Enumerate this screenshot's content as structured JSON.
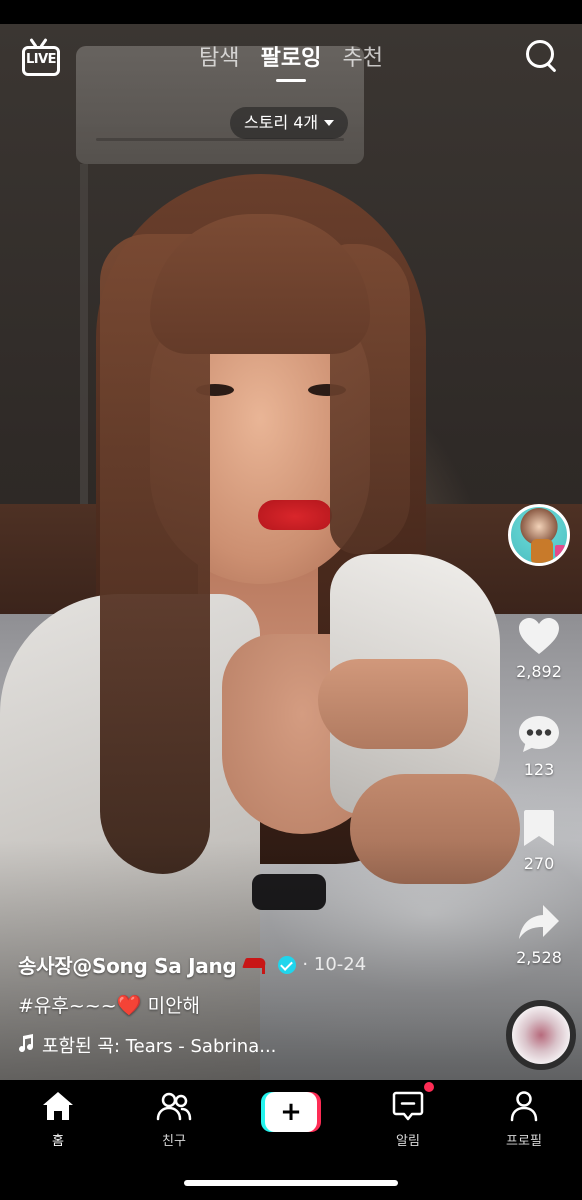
{
  "top_bar": {
    "live_label": "LIVE",
    "tabs": [
      {
        "label": "탐색",
        "active": false
      },
      {
        "label": "팔로잉",
        "active": true
      },
      {
        "label": "추천",
        "active": false
      }
    ],
    "story_pill": "스토리 4개"
  },
  "rail": {
    "likes": "2,892",
    "comments": "123",
    "saves": "270",
    "shares": "2,528"
  },
  "caption": {
    "author": "송사장@Song Sa Jang",
    "date": "· 10-24",
    "text_before": "#유후~~~",
    "heart": "❤️",
    "text_after": "미안해",
    "music": "포함된 곡: Tears - Sabrina..."
  },
  "bottom_nav": {
    "items": [
      {
        "label": "홈",
        "active": true
      },
      {
        "label": "친구",
        "active": false
      },
      {
        "label": "알림",
        "active": false
      },
      {
        "label": "프로필",
        "active": false
      }
    ]
  },
  "colors": {
    "verified": "#20d5ec",
    "create_cyan": "#25f4ee",
    "create_pink": "#fe2c55",
    "notification_dot": "#fe2c55"
  }
}
